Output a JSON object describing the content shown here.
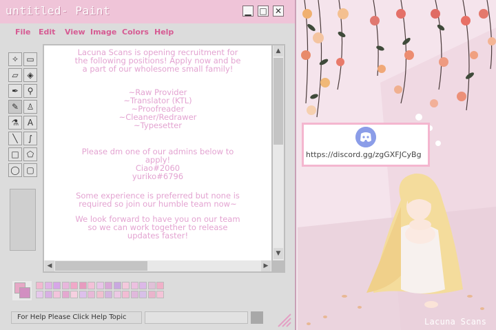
{
  "window": {
    "title": "untitled- Paint",
    "minimize_label": "▁",
    "maximize_label": "□",
    "close_label": "✕"
  },
  "menu": [
    "File",
    "Edit",
    "View",
    "Image",
    "Colors",
    "Help"
  ],
  "tools": [
    {
      "name": "free-select-icon",
      "glyph": "✧"
    },
    {
      "name": "rect-select-icon",
      "glyph": "▭"
    },
    {
      "name": "eraser-icon",
      "glyph": "▱"
    },
    {
      "name": "fill-icon",
      "glyph": "◈"
    },
    {
      "name": "color-picker-icon",
      "glyph": "✒"
    },
    {
      "name": "magnifier-icon",
      "glyph": "⚲"
    },
    {
      "name": "pencil-icon",
      "glyph": "✎"
    },
    {
      "name": "brush-icon",
      "glyph": "♙"
    },
    {
      "name": "airbrush-icon",
      "glyph": "⚗"
    },
    {
      "name": "text-icon",
      "glyph": "A"
    },
    {
      "name": "line-icon",
      "glyph": "╲"
    },
    {
      "name": "curve-icon",
      "glyph": "∫"
    },
    {
      "name": "rectangle-icon",
      "glyph": "□"
    },
    {
      "name": "polygon-icon",
      "glyph": "⬠"
    },
    {
      "name": "ellipse-icon",
      "glyph": "◯"
    },
    {
      "name": "rounded-rect-icon",
      "glyph": "▢"
    }
  ],
  "canvas": {
    "intro": [
      "Lacuna Scans is opening recruitment for",
      "the following positions! Apply now and be",
      "a part of our wholesome small family!"
    ],
    "positions": [
      "~Raw Provider",
      "~Translator (KTL)",
      "~Proofreader",
      "~Cleaner/Redrawer",
      "~Typesetter"
    ],
    "contact": [
      "Please dm one of our admins below to",
      "apply!",
      "Ciao#2060",
      "yuriko#6796"
    ],
    "experience": [
      "Some experience is preferred but none is",
      "required so join our humble team now~"
    ],
    "closing": [
      "We look forward to have you on our team",
      "so we can work together to release",
      "updates faster!"
    ]
  },
  "scroll": {
    "up": "▲",
    "down": "▼",
    "left": "◀",
    "right": "▶"
  },
  "palette": {
    "primary": "#e7a8c6",
    "secondary": "#d28fc1",
    "swatches": [
      "#f2b8d0",
      "#e0b3e6",
      "#d7a6e8",
      "#e8b6dc",
      "#f0a8c8",
      "#e79bbf",
      "#f3c0d8",
      "#e8c4e8",
      "#d9a8d8",
      "#c9a8e0",
      "#f4c8dc",
      "#ecc0e0",
      "#dcb8e8",
      "#e0c0d8",
      "#f0b0c8",
      "#e6c8ec",
      "#d8b0e4",
      "#f2c4dc",
      "#e4a8d0",
      "#f6d0e0",
      "#ddc0ec",
      "#e8b8d8",
      "#f0c0d0",
      "#d4b4e0",
      "#ecc8e4",
      "#f2bcd4",
      "#e0b8dc",
      "#d8c0e8",
      "#eab4cc",
      "#f4c4d8"
    ]
  },
  "status": {
    "text": "For Help Please Click Help Topic"
  },
  "discord": {
    "url": "https://discord.gg/zgGXFJCyBg"
  },
  "watermark": "Lacuna Scans"
}
